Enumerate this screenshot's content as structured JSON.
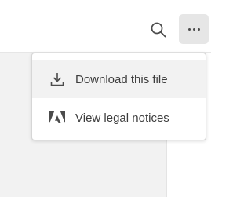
{
  "toolbar": {
    "search_icon": "search-icon",
    "more_icon": "more-options-icon"
  },
  "menu": {
    "items": [
      {
        "label": "Download this file",
        "icon": "download-icon",
        "highlighted": true
      },
      {
        "label": "View legal notices",
        "icon": "adobe-logo-icon",
        "highlighted": false
      }
    ]
  },
  "colors": {
    "menu_text": "#3d3d3d",
    "hover_bg": "#f2f2f2",
    "button_bg": "#e6e6e6",
    "icon": "#4b4b4b"
  }
}
